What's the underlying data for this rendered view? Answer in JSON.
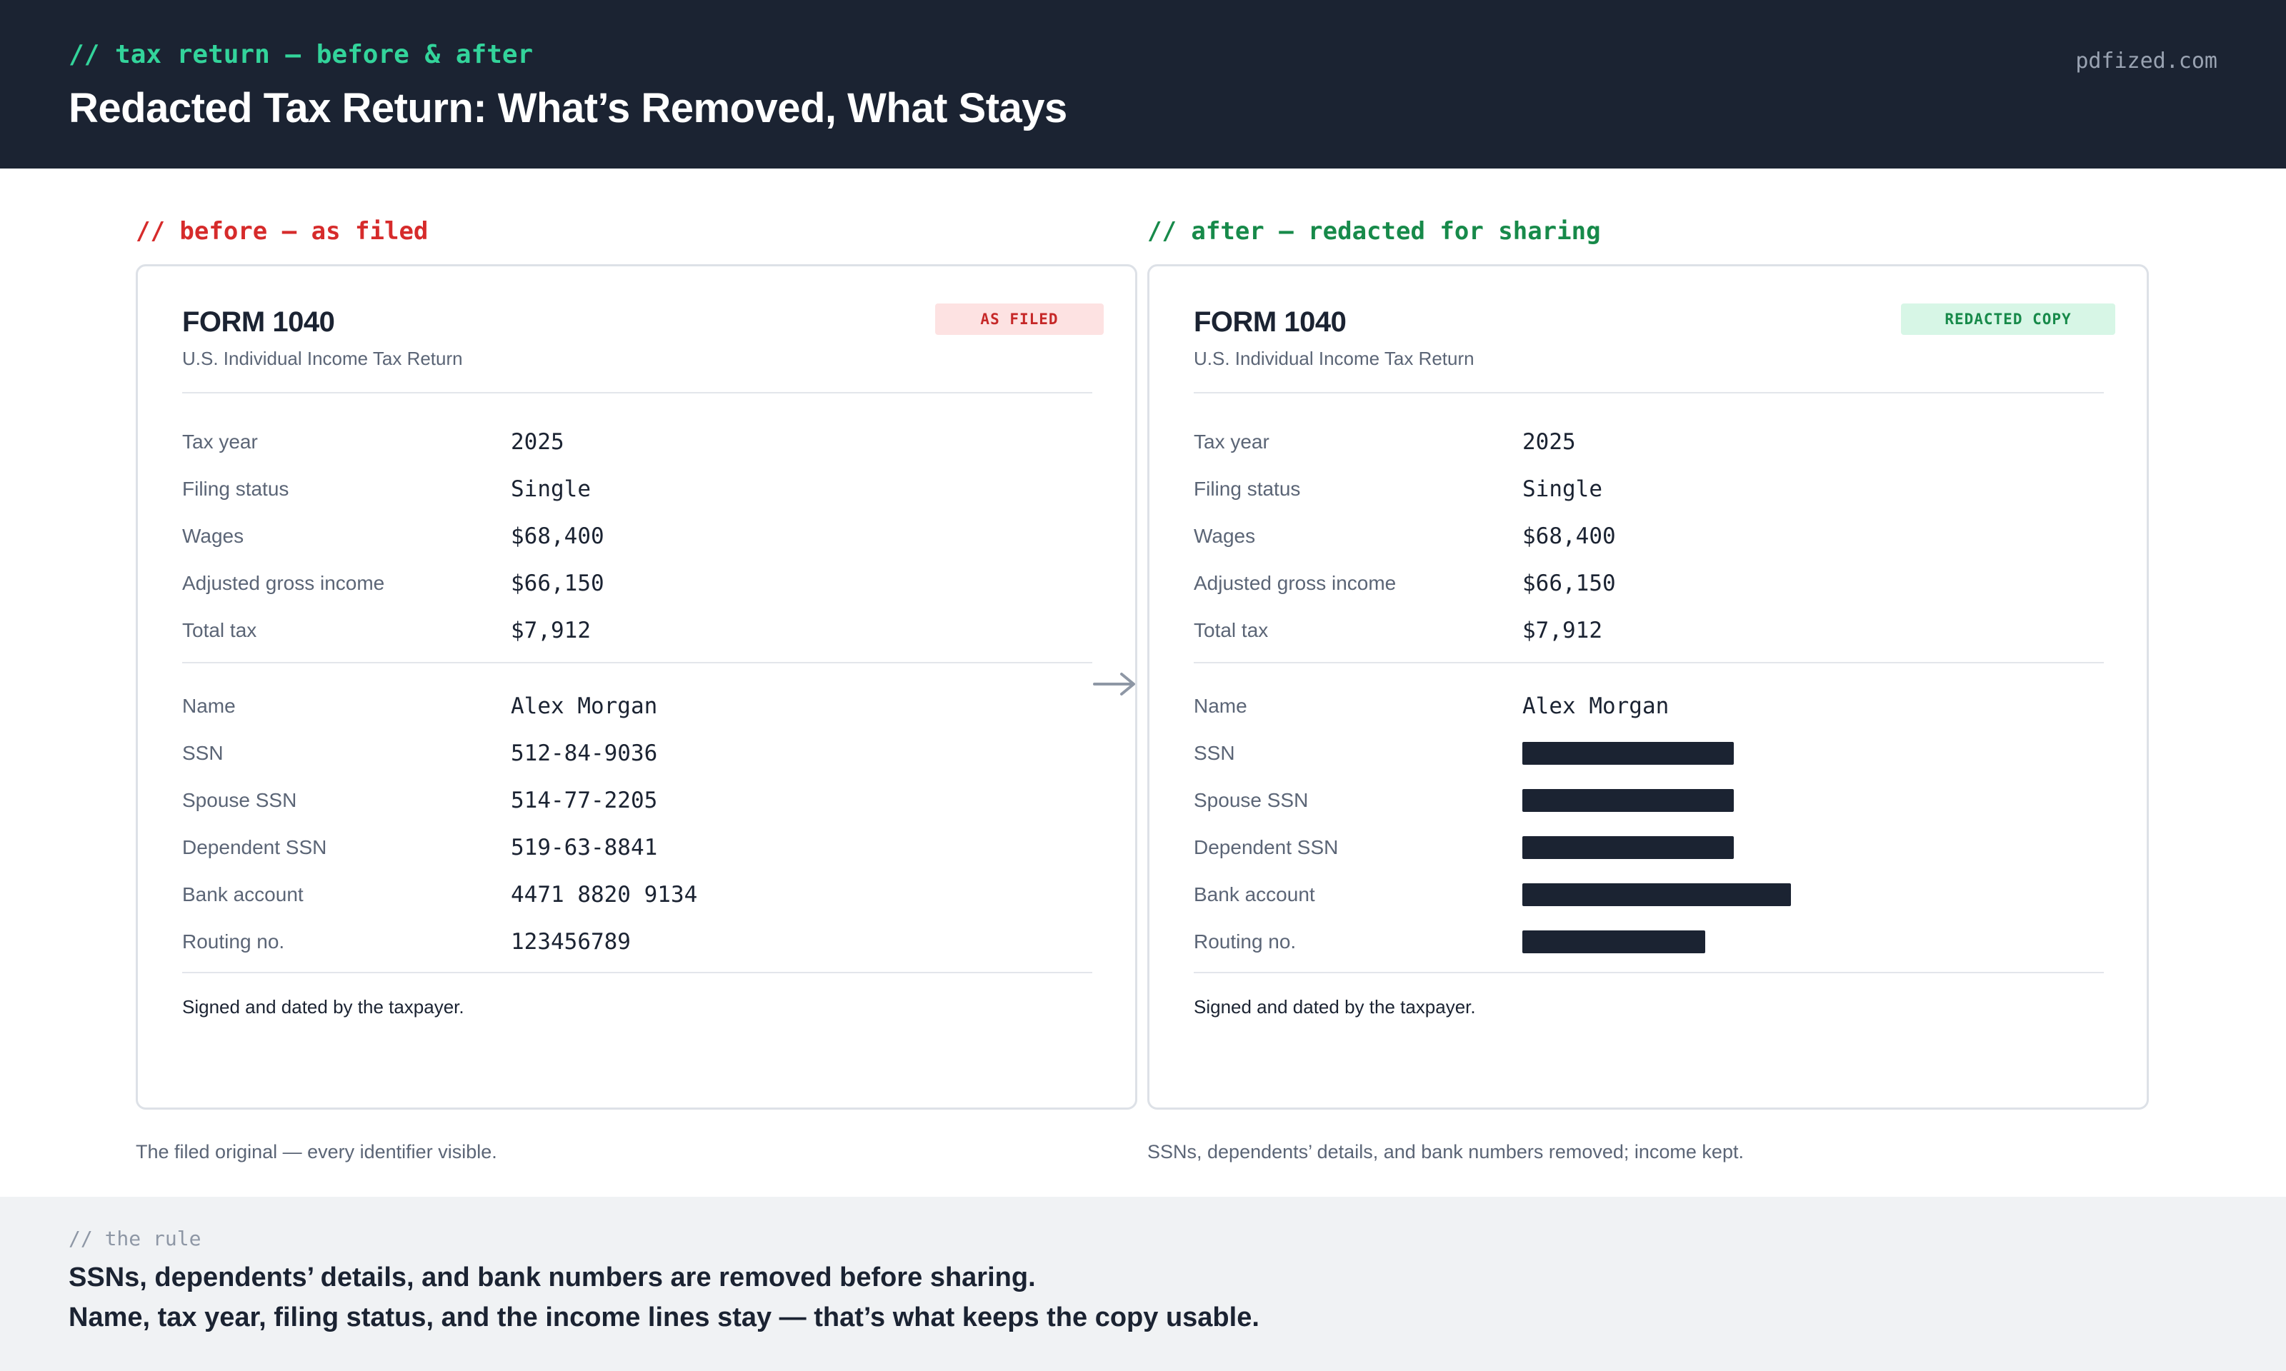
{
  "header": {
    "kicker": "// tax return — before & after",
    "title": "Redacted Tax Return: What’s Removed, What Stays",
    "brand": "pdfized.com"
  },
  "before": {
    "section_label": "// before — as filed",
    "form_title": "FORM 1040",
    "form_subtitle": "U.S. Individual Income Tax Return",
    "badge": "AS FILED",
    "income_rows": [
      {
        "label": "Tax year",
        "value": "2025"
      },
      {
        "label": "Filing status",
        "value": "Single"
      },
      {
        "label": "Wages",
        "value": "$68,400"
      },
      {
        "label": "Adjusted gross income",
        "value": "$66,150"
      },
      {
        "label": "Total tax",
        "value": "$7,912"
      }
    ],
    "identity_rows": [
      {
        "label": "Name",
        "value": "Alex Morgan"
      },
      {
        "label": "SSN",
        "value": "512-84-9036"
      },
      {
        "label": "Spouse SSN",
        "value": "514-77-2205"
      },
      {
        "label": "Dependent SSN",
        "value": "519-63-8841"
      },
      {
        "label": "Bank account",
        "value": "4471 8820 9134"
      },
      {
        "label": "Routing no.",
        "value": "123456789"
      }
    ],
    "signed": "Signed and dated by the taxpayer.",
    "caption": "The filed original — every identifier visible."
  },
  "after": {
    "section_label": "// after — redacted for sharing",
    "form_title": "FORM 1040",
    "form_subtitle": "U.S. Individual Income Tax Return",
    "badge": "REDACTED COPY",
    "income_rows": [
      {
        "label": "Tax year",
        "value": "2025"
      },
      {
        "label": "Filing status",
        "value": "Single"
      },
      {
        "label": "Wages",
        "value": "$68,400"
      },
      {
        "label": "Adjusted gross income",
        "value": "$66,150"
      },
      {
        "label": "Total tax",
        "value": "$7,912"
      }
    ],
    "identity_rows": [
      {
        "label": "Name",
        "value": "Alex Morgan"
      },
      {
        "label": "SSN",
        "redacted": true
      },
      {
        "label": "Spouse SSN",
        "redacted": true
      },
      {
        "label": "Dependent SSN",
        "redacted": true
      },
      {
        "label": "Bank account",
        "redacted": true
      },
      {
        "label": "Routing no.",
        "redacted": true
      }
    ],
    "signed": "Signed and dated by the taxpayer.",
    "caption": "SSNs, dependents’ details, and bank numbers removed; income kept."
  },
  "footer": {
    "kicker": "// the rule",
    "line1": "SSNs, dependents’ details, and bank numbers are removed before sharing.",
    "line2": "Name, tax year, filing status, and the income lines stay — that’s what keeps the copy usable."
  },
  "colors": {
    "header_bg": "#1b2332",
    "accent_green": "#33d49b",
    "before_red": "#d62b2b",
    "after_green": "#178a4a",
    "redaction_bar": "#1b2332",
    "footer_bg": "#f0f2f4"
  },
  "icons": {
    "transition_arrow": "right-arrow-icon"
  }
}
